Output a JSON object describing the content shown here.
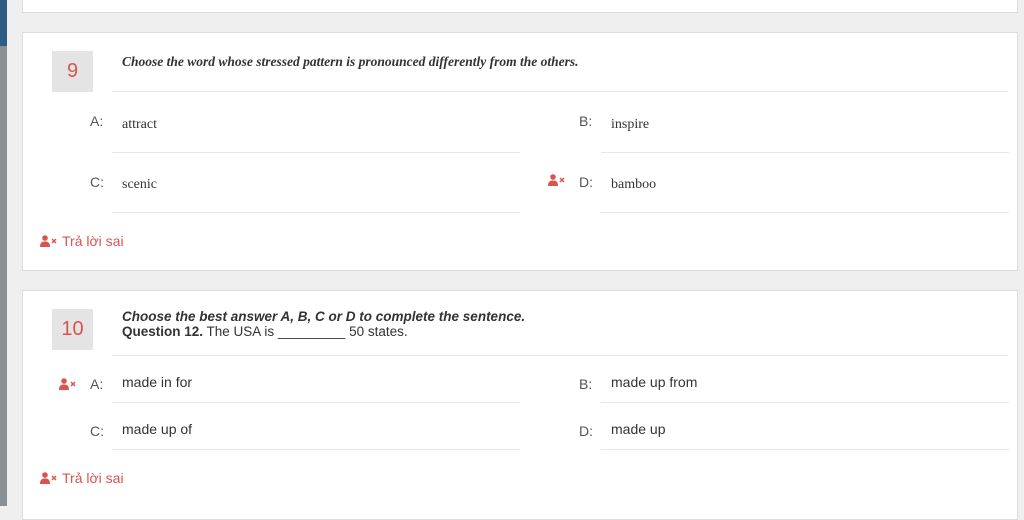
{
  "questions": [
    {
      "number": "9",
      "prompt": "Choose the word whose stressed pattern is pronounced differently from the others.",
      "options": [
        {
          "letter": "A:",
          "text": "attract"
        },
        {
          "letter": "B:",
          "text": "inspire"
        },
        {
          "letter": "C:",
          "text": "scenic"
        },
        {
          "letter": "D:",
          "text": "bamboo"
        }
      ],
      "selected": "D",
      "result_label": "Trả lời sai"
    },
    {
      "number": "10",
      "instruction": "Choose the best answer A, B, C or D to complete the sentence.",
      "question_label": "Question 12.",
      "question_text": " The USA is _________ 50 states.",
      "options": [
        {
          "letter": "A:",
          "text": "made in for"
        },
        {
          "letter": "B:",
          "text": "made up from"
        },
        {
          "letter": "C:",
          "text": "made up of"
        },
        {
          "letter": "D:",
          "text": "made up"
        }
      ],
      "selected": "A",
      "result_label": "Trả lời sai"
    }
  ],
  "icons": {
    "wrong_answer": "user-x-icon"
  },
  "colors": {
    "wrong": "#d9534f",
    "page_background": "#efefef"
  }
}
